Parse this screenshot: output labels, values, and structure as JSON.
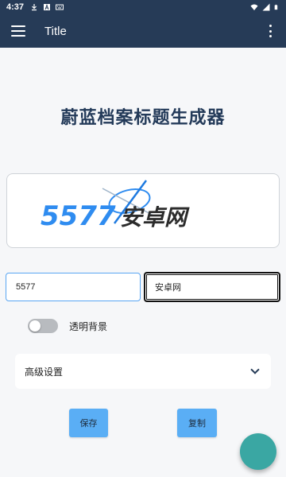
{
  "status_bar": {
    "time": "4:37",
    "icons_left": [
      "download-icon",
      "a-icon",
      "keyboard-icon"
    ],
    "icons_right": [
      "wifi-icon",
      "signal-icon",
      "battery-icon"
    ]
  },
  "app_bar": {
    "title": "Title",
    "menu_icon": "hamburger-menu-icon",
    "more_icon": "more-vert-icon",
    "background": "#263b57"
  },
  "main": {
    "heading": "蔚蓝档案标题生成器",
    "preview": {
      "left_text": "5577",
      "right_text": "安卓网",
      "left_color": "#2f8cf0",
      "right_color": "#2b2b2b",
      "halo_color": "#2f8cf0"
    },
    "inputs": {
      "left_value": "5577",
      "right_value": "安卓网"
    },
    "transparent_bg": {
      "label": "透明背景",
      "enabled": false
    },
    "advanced": {
      "label": "高级设置",
      "expanded": false
    },
    "buttons": {
      "save": "保存",
      "copy": "复制"
    },
    "fab_color": "#3aa7a3"
  }
}
